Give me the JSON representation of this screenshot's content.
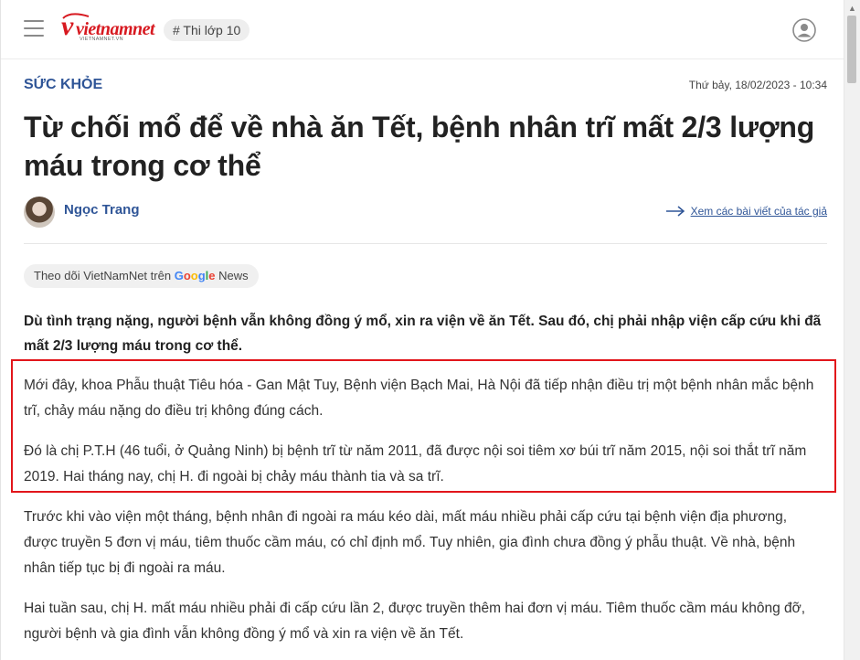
{
  "header": {
    "logo": {
      "main": "vietnamnet",
      "sub": "VIETNAMNET.VN"
    },
    "tag_label": "# Thi lớp 10"
  },
  "article": {
    "category": "SỨC KHỎE",
    "date": "Thứ bảy, 18/02/2023 - 10:34",
    "title": "Từ chối mổ để về nhà ăn Tết, bệnh nhân trĩ mất 2/3 lượng máu trong cơ thể",
    "author": {
      "name": "Ngọc Trang",
      "link_label": "Xem các bài viết của tác giả"
    },
    "follow": {
      "prefix": "Theo dõi VietNamNet trên",
      "brand_letters": [
        "G",
        "o",
        "o",
        "g",
        "l",
        "e"
      ],
      "suffix": "News"
    },
    "sapo": "Dù tình trạng nặng, người bệnh vẫn không đồng ý mổ, xin ra viện về ăn Tết. Sau đó, chị phải nhập viện cấp cứu khi đã mất 2/3 lượng máu trong cơ thể.",
    "paragraphs": [
      "Mới đây, khoa Phẫu thuật Tiêu hóa - Gan Mật Tuy, Bệnh viện Bạch Mai, Hà Nội đã tiếp nhận điều trị một bệnh nhân mắc bệnh trĩ, chảy máu nặng do điều trị không đúng cách.",
      "Đó là chị P.T.H (46 tuổi, ở Quảng Ninh) bị bệnh trĩ từ năm 2011, đã được nội soi tiêm xơ búi trĩ năm 2015, nội soi thắt trĩ năm 2019. Hai tháng nay, chị H. đi ngoài bị chảy máu thành tia và sa trĩ.",
      "Trước khi vào viện một tháng, bệnh nhân đi ngoài ra máu kéo dài, mất máu nhiều phải cấp cứu tại bệnh viện địa phương, được truyền 5 đơn vị máu, tiêm thuốc cầm máu, có chỉ định mổ. Tuy nhiên, gia đình chưa đồng ý phẫu thuật. Về nhà, bệnh nhân tiếp tục bị đi ngoài ra máu.",
      "Hai tuần sau, chị H. mất máu nhiều phải đi cấp cứu lần 2, được truyền thêm hai đơn vị máu. Tiêm thuốc cầm máu không đỡ, người bệnh và gia đình vẫn không đồng ý mổ và xin ra viện về ăn Tết."
    ]
  },
  "colors": {
    "brand_red": "#d71920",
    "accent_blue": "#2f5597",
    "highlight_border": "#e2161b"
  }
}
